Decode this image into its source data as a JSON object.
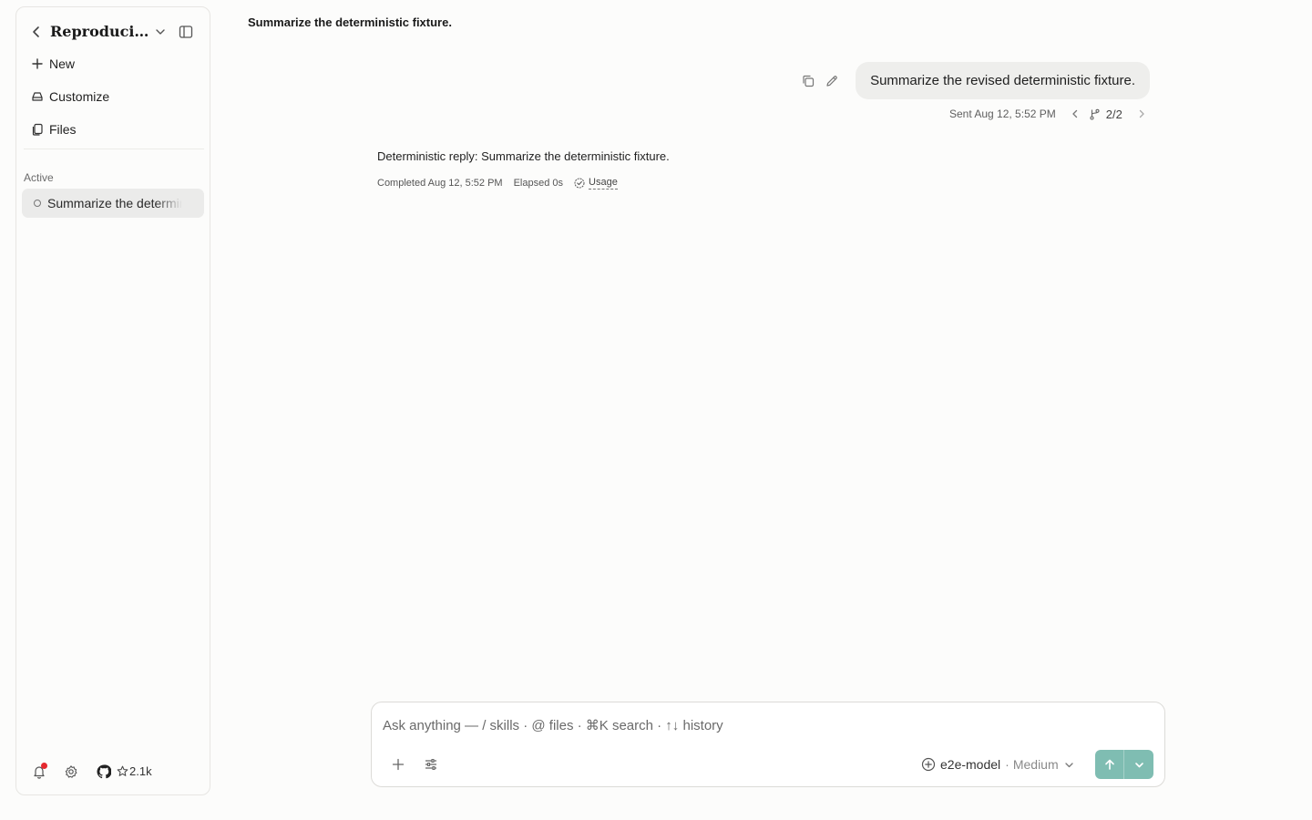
{
  "sidebar": {
    "project_title": "Reproducible...",
    "nav": [
      {
        "label": "New",
        "icon": "plus-icon"
      },
      {
        "label": "Customize",
        "icon": "customize-icon"
      },
      {
        "label": "Files",
        "icon": "files-icon"
      }
    ],
    "section_label": "Active",
    "threads": [
      {
        "label": "Summarize the deterministic fixture.",
        "status_icon": "circle-icon"
      }
    ],
    "footer": {
      "github_stars": "2.1k",
      "notification_dot_color": "#e5292f"
    }
  },
  "conversation": {
    "title": "Summarize the deterministic fixture.",
    "user_message": {
      "text": "Summarize the revised deterministic fixture.",
      "sent": "Sent Aug 12, 5:52 PM",
      "branch": "2/2"
    },
    "assistant_message": {
      "text": "Deterministic reply: Summarize the deterministic fixture.",
      "completed": "Completed Aug 12, 5:52 PM",
      "elapsed": "Elapsed 0s",
      "usage_label": "Usage"
    }
  },
  "composer": {
    "placeholder": "Ask anything — / skills · @ files · ⌘K search · ↑↓ history",
    "model": "e2e-model",
    "separator": "·",
    "effort": "Medium",
    "accent_color": "#7fbdb2"
  }
}
